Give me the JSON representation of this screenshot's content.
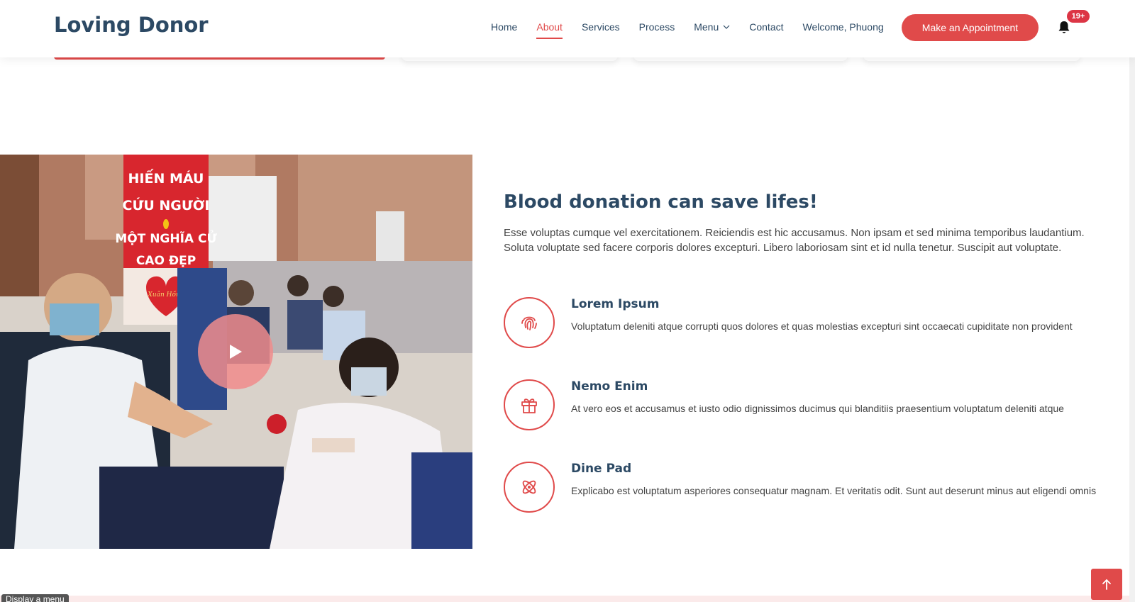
{
  "header": {
    "logo": "Loving Donor",
    "nav": [
      "Home",
      "About",
      "Services",
      "Process",
      "Menu",
      "Contact",
      "Welcome, Phuong"
    ],
    "active": "About",
    "appointment_label": "Make an Appointment",
    "notification_badge": "19+"
  },
  "about": {
    "title": "Blood donation can save lifes!",
    "intro": "Esse voluptas cumque vel exercitationem. Reiciendis est hic accusamus. Non ipsam et sed minima temporibus laudantium. Soluta voluptate sed facere corporis dolores excepturi. Libero laboriosam sint et id nulla tenetur. Suscipit aut voluptate.",
    "features": [
      {
        "icon": "fingerprint-icon",
        "title": "Lorem Ipsum",
        "desc": "Voluptatum deleniti atque corrupti quos dolores et quas molestias excepturi sint occaecati cupiditate non provident"
      },
      {
        "icon": "gift-icon",
        "title": "Nemo Enim",
        "desc": "At vero eos et accusamus et iusto odio dignissimos ducimus qui blanditiis praesentium voluptatum deleniti atque"
      },
      {
        "icon": "atom-icon",
        "title": "Dine Pad",
        "desc": "Explicabo est voluptatum asperiores consequatur magnam. Et veritatis odit. Sunt aut deserunt minus aut eligendi omnis"
      }
    ]
  },
  "photo": {
    "banner_lines": [
      "HIẾN MÁU",
      "CỨU NGƯỜI",
      "MỘT NGHĨA CỬ",
      "CAO ĐẸP"
    ],
    "heart_text": "Xuân Hồng"
  },
  "footer": {
    "display_menu": "Display a menu"
  },
  "colors": {
    "accent": "#e04a4a",
    "heading": "#2c4964",
    "body_text": "#444444",
    "badge": "#dc3545"
  }
}
